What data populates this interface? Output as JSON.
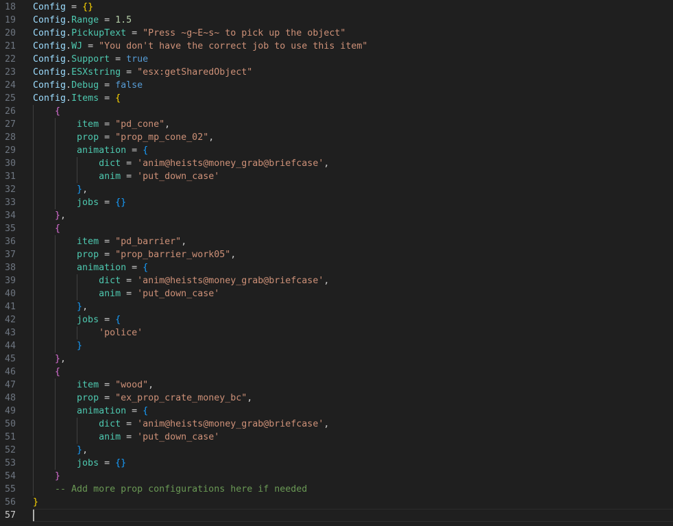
{
  "editor": {
    "language": "lua",
    "current_line": 57,
    "colors": {
      "background": "#1f1f1f",
      "variable": "#9cdcfe",
      "property": "#4ec9b0",
      "string": "#ce9178",
      "number": "#b5cea8",
      "keyword": "#569cd6",
      "bracket1": "#ffd700",
      "bracket2": "#da70d6",
      "bracket3": "#179fff",
      "comment": "#6a9955"
    },
    "lines": [
      {
        "n": "18",
        "t": [
          [
            "v",
            "Config"
          ],
          [
            "o",
            " = "
          ],
          [
            "b1",
            "{}"
          ]
        ]
      },
      {
        "n": "19",
        "t": [
          [
            "v",
            "Config"
          ],
          [
            "o",
            "."
          ],
          [
            "p",
            "Range"
          ],
          [
            "o",
            " = "
          ],
          [
            "n",
            "1.5"
          ]
        ]
      },
      {
        "n": "20",
        "t": [
          [
            "v",
            "Config"
          ],
          [
            "o",
            "."
          ],
          [
            "p",
            "PickupText"
          ],
          [
            "o",
            " = "
          ],
          [
            "s",
            "\"Press ~g~E~s~ to pick up the object\""
          ]
        ]
      },
      {
        "n": "21",
        "t": [
          [
            "v",
            "Config"
          ],
          [
            "o",
            "."
          ],
          [
            "p",
            "WJ"
          ],
          [
            "o",
            " = "
          ],
          [
            "s",
            "\"You don't have the correct job to use this item\""
          ]
        ]
      },
      {
        "n": "22",
        "t": [
          [
            "v",
            "Config"
          ],
          [
            "o",
            "."
          ],
          [
            "p",
            "Support"
          ],
          [
            "o",
            " = "
          ],
          [
            "k",
            "true"
          ]
        ]
      },
      {
        "n": "23",
        "t": [
          [
            "v",
            "Config"
          ],
          [
            "o",
            "."
          ],
          [
            "p",
            "ESXstring"
          ],
          [
            "o",
            " = "
          ],
          [
            "s",
            "\"esx:getSharedObject\""
          ]
        ]
      },
      {
        "n": "24",
        "t": [
          [
            "v",
            "Config"
          ],
          [
            "o",
            "."
          ],
          [
            "p",
            "Debug"
          ],
          [
            "o",
            " = "
          ],
          [
            "k",
            "false"
          ]
        ]
      },
      {
        "n": "25",
        "t": [
          [
            "v",
            "Config"
          ],
          [
            "o",
            "."
          ],
          [
            "p",
            "Items"
          ],
          [
            "o",
            " = "
          ],
          [
            "b1",
            "{"
          ]
        ]
      },
      {
        "n": "26",
        "t": [
          [
            "o",
            "    "
          ],
          [
            "b2",
            "{"
          ]
        ]
      },
      {
        "n": "27",
        "t": [
          [
            "o",
            "        "
          ],
          [
            "p",
            "item"
          ],
          [
            "o",
            " = "
          ],
          [
            "s",
            "\"pd_cone\""
          ],
          [
            "o",
            ","
          ]
        ]
      },
      {
        "n": "28",
        "t": [
          [
            "o",
            "        "
          ],
          [
            "p",
            "prop"
          ],
          [
            "o",
            " = "
          ],
          [
            "s",
            "\"prop_mp_cone_02\""
          ],
          [
            "o",
            ","
          ]
        ]
      },
      {
        "n": "29",
        "t": [
          [
            "o",
            "        "
          ],
          [
            "p",
            "animation"
          ],
          [
            "o",
            " = "
          ],
          [
            "b3",
            "{"
          ]
        ]
      },
      {
        "n": "30",
        "t": [
          [
            "o",
            "            "
          ],
          [
            "p",
            "dict"
          ],
          [
            "o",
            " = "
          ],
          [
            "s",
            "'anim@heists@money_grab@briefcase'"
          ],
          [
            "o",
            ","
          ]
        ]
      },
      {
        "n": "31",
        "t": [
          [
            "o",
            "            "
          ],
          [
            "p",
            "anim"
          ],
          [
            "o",
            " = "
          ],
          [
            "s",
            "'put_down_case'"
          ]
        ]
      },
      {
        "n": "32",
        "t": [
          [
            "o",
            "        "
          ],
          [
            "b3",
            "}"
          ],
          [
            "o",
            ","
          ]
        ]
      },
      {
        "n": "33",
        "t": [
          [
            "o",
            "        "
          ],
          [
            "p",
            "jobs"
          ],
          [
            "o",
            " = "
          ],
          [
            "b3",
            "{}"
          ]
        ]
      },
      {
        "n": "34",
        "t": [
          [
            "o",
            "    "
          ],
          [
            "b2",
            "}"
          ],
          [
            "o",
            ","
          ]
        ]
      },
      {
        "n": "35",
        "t": [
          [
            "o",
            "    "
          ],
          [
            "b2",
            "{"
          ]
        ]
      },
      {
        "n": "36",
        "t": [
          [
            "o",
            "        "
          ],
          [
            "p",
            "item"
          ],
          [
            "o",
            " = "
          ],
          [
            "s",
            "\"pd_barrier\""
          ],
          [
            "o",
            ","
          ]
        ]
      },
      {
        "n": "37",
        "t": [
          [
            "o",
            "        "
          ],
          [
            "p",
            "prop"
          ],
          [
            "o",
            " = "
          ],
          [
            "s",
            "\"prop_barrier_work05\""
          ],
          [
            "o",
            ","
          ]
        ]
      },
      {
        "n": "38",
        "t": [
          [
            "o",
            "        "
          ],
          [
            "p",
            "animation"
          ],
          [
            "o",
            " = "
          ],
          [
            "b3",
            "{"
          ]
        ]
      },
      {
        "n": "39",
        "t": [
          [
            "o",
            "            "
          ],
          [
            "p",
            "dict"
          ],
          [
            "o",
            " = "
          ],
          [
            "s",
            "'anim@heists@money_grab@briefcase'"
          ],
          [
            "o",
            ","
          ]
        ]
      },
      {
        "n": "40",
        "t": [
          [
            "o",
            "            "
          ],
          [
            "p",
            "anim"
          ],
          [
            "o",
            " = "
          ],
          [
            "s",
            "'put_down_case'"
          ]
        ]
      },
      {
        "n": "41",
        "t": [
          [
            "o",
            "        "
          ],
          [
            "b3",
            "}"
          ],
          [
            "o",
            ","
          ]
        ]
      },
      {
        "n": "42",
        "t": [
          [
            "o",
            "        "
          ],
          [
            "p",
            "jobs"
          ],
          [
            "o",
            " = "
          ],
          [
            "b3",
            "{"
          ]
        ]
      },
      {
        "n": "43",
        "t": [
          [
            "o",
            "            "
          ],
          [
            "s",
            "'police'"
          ]
        ]
      },
      {
        "n": "44",
        "t": [
          [
            "o",
            "        "
          ],
          [
            "b3",
            "}"
          ]
        ]
      },
      {
        "n": "45",
        "t": [
          [
            "o",
            "    "
          ],
          [
            "b2",
            "}"
          ],
          [
            "o",
            ","
          ]
        ]
      },
      {
        "n": "46",
        "t": [
          [
            "o",
            "    "
          ],
          [
            "b2",
            "{"
          ]
        ]
      },
      {
        "n": "47",
        "t": [
          [
            "o",
            "        "
          ],
          [
            "p",
            "item"
          ],
          [
            "o",
            " = "
          ],
          [
            "s",
            "\"wood\""
          ],
          [
            "o",
            ","
          ]
        ]
      },
      {
        "n": "48",
        "t": [
          [
            "o",
            "        "
          ],
          [
            "p",
            "prop"
          ],
          [
            "o",
            " = "
          ],
          [
            "s",
            "\"ex_prop_crate_money_bc\""
          ],
          [
            "o",
            ","
          ]
        ]
      },
      {
        "n": "49",
        "t": [
          [
            "o",
            "        "
          ],
          [
            "p",
            "animation"
          ],
          [
            "o",
            " = "
          ],
          [
            "b3",
            "{"
          ]
        ]
      },
      {
        "n": "50",
        "t": [
          [
            "o",
            "            "
          ],
          [
            "p",
            "dict"
          ],
          [
            "o",
            " = "
          ],
          [
            "s",
            "'anim@heists@money_grab@briefcase'"
          ],
          [
            "o",
            ","
          ]
        ]
      },
      {
        "n": "51",
        "t": [
          [
            "o",
            "            "
          ],
          [
            "p",
            "anim"
          ],
          [
            "o",
            " = "
          ],
          [
            "s",
            "'put_down_case'"
          ]
        ]
      },
      {
        "n": "52",
        "t": [
          [
            "o",
            "        "
          ],
          [
            "b3",
            "}"
          ],
          [
            "o",
            ","
          ]
        ]
      },
      {
        "n": "53",
        "t": [
          [
            "o",
            "        "
          ],
          [
            "p",
            "jobs"
          ],
          [
            "o",
            " = "
          ],
          [
            "b3",
            "{}"
          ]
        ]
      },
      {
        "n": "54",
        "t": [
          [
            "o",
            "    "
          ],
          [
            "b2",
            "}"
          ]
        ]
      },
      {
        "n": "55",
        "t": [
          [
            "o",
            "    "
          ],
          [
            "c",
            "-- Add more prop configurations here if needed"
          ]
        ]
      },
      {
        "n": "56",
        "t": [
          [
            "b1",
            "}"
          ]
        ]
      },
      {
        "n": "57",
        "t": []
      }
    ]
  }
}
